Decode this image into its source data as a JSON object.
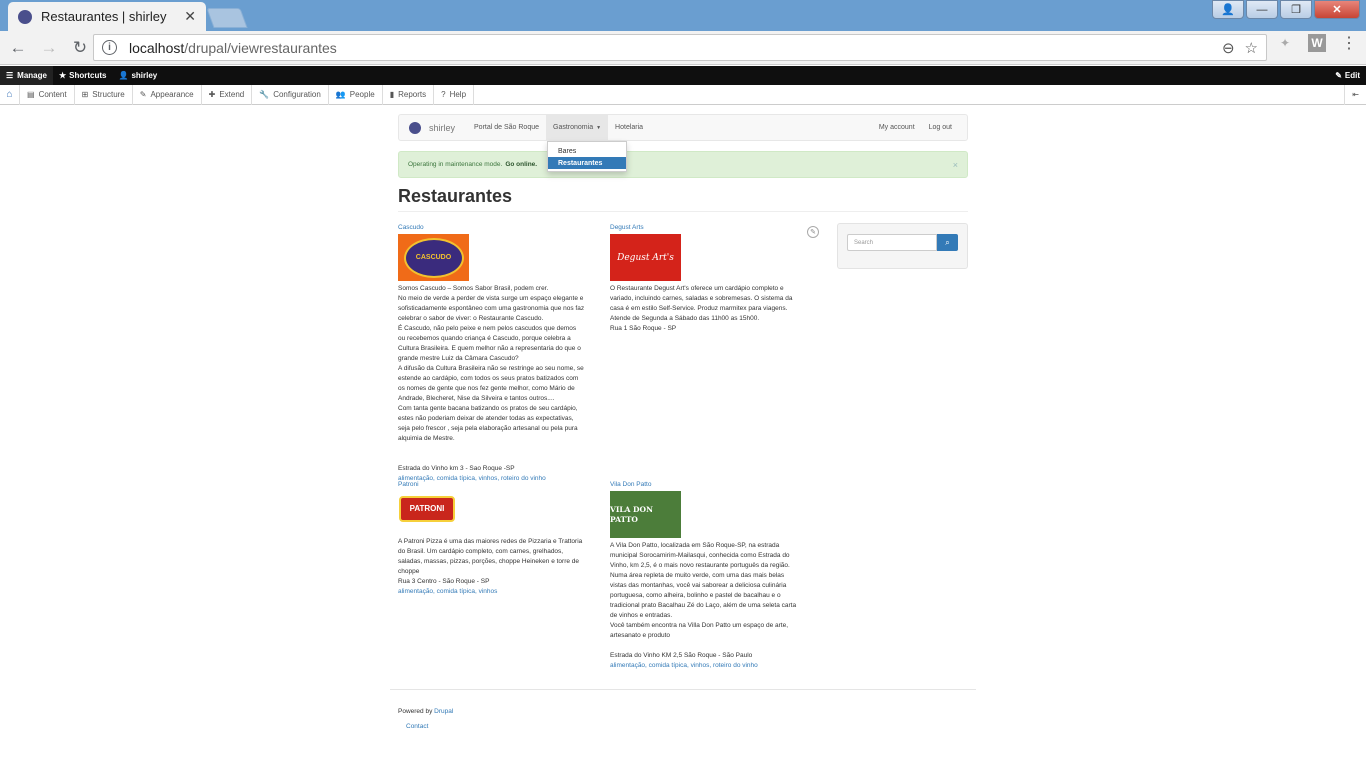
{
  "browser": {
    "tab_title": "Restaurantes | shirley",
    "tab_close": "✕",
    "url_host": "localhost",
    "url_path": "/drupal/viewrestaurantes",
    "back": "←",
    "forward": "→",
    "reload": "↻",
    "zoom_icon": "⊖",
    "star_icon": "☆",
    "menu_icon": "⋮",
    "ext_w": "W",
    "win_min": "—",
    "win_max": "❐",
    "win_close": "✕",
    "win_user": "👤"
  },
  "admin_bar": {
    "manage": "Manage",
    "shortcuts": "Shortcuts",
    "user": "shirley",
    "edit": "Edit"
  },
  "admin_tray": {
    "items": [
      "Content",
      "Structure",
      "Appearance",
      "Extend",
      "Configuration",
      "People",
      "Reports",
      "Help"
    ]
  },
  "site": {
    "brand": "shirley",
    "nav": [
      "Portal de São Roque",
      "Gastronomia",
      "Hotelaria"
    ],
    "nav_right": [
      "My account",
      "Log out"
    ],
    "dropdown": [
      "Bares",
      "Restaurantes"
    ]
  },
  "alert": {
    "text": "Operating in maintenance mode.",
    "link": "Go online.",
    "close": "×"
  },
  "page_title": "Restaurantes",
  "entries": [
    {
      "name": "Cascudo",
      "logo_text": "CASCUDO",
      "body": [
        "Somos Cascudo – Somos Sabor Brasil, podem crer.",
        "No meio de verde a perder de vista surge um espaço elegante e",
        "sofisticadamente espontâneo com uma gastronomia que nos faz",
        "celebrar o sabor de viver: o Restaurante Cascudo.",
        "É Cascudo, não pelo peixe e nem pelos cascudos que demos",
        "ou recebemos quando criança é Cascudo, porque celebra a",
        "Cultura Brasileira. E quem melhor não a representaria do que o",
        "grande mestre Luiz da Câmara Cascudo?",
        "A difusão da Cultura Brasileira não se restringe ao seu nome, se",
        "estende ao cardápio, com todos os seus pratos batizados com",
        "os nomes de gente que nos fez gente melhor, como Mário de",
        "Andrade, Blecheret, Nise da Silveira e tantos outros....",
        "Com tanta gente bacana batizando os pratos de seu cardápio,",
        "estes não poderiam deixar de atender todas as expectativas,",
        "seja pelo frescor , seja pela elaboração artesanal ou pela pura",
        "alquimia de Mestre.",
        "",
        "",
        "Estrada do Vinho km 3 - Sao Roque -SP"
      ],
      "tags": "alimentação, comida típica, vinhos, roteiro do vinho"
    },
    {
      "name": "Degust Arts",
      "logo_text": "Degust Art's",
      "body": [
        "O Restaurante Degust Art's oferece um cardápio completo e",
        "variado, incluindo carnes, saladas e sobremesas. O sistema da",
        "casa é em estilo Self-Service. Produz marmitex para viagens.",
        "Atende de Segunda a Sábado das 11h00 as 15h00.",
        "Rua 1 São Roque - SP"
      ],
      "tags": ""
    },
    {
      "name": "Patroni",
      "logo_text": "PATRONI",
      "body": [
        "A Patroni Pizza é uma das maiores redes de Pizzaria e Trattoria",
        "do Brasil. Um cardápio completo, com carnes, grelhados,",
        "saladas, massas, pizzas, porções, choppe Heineken e torre de",
        "choppe",
        "Rua 3 Centro - São Roque - SP"
      ],
      "tags": "alimentação, comida típica, vinhos"
    },
    {
      "name": "Vila Don Patto",
      "logo_text": "VILA DON PATTO",
      "body": [
        "A Vila Don Patto, localizada em São Roque-SP, na estrada",
        "municipal Sorocamirim-Mailasqui, conhecida como Estrada do",
        "Vinho, km 2,5, é o mais novo restaurante português da região.",
        "Numa área repleta de muito verde, com uma das mais belas",
        "vistas das montanhas, você vai saborear a deliciosa culinária",
        "portuguesa, como alheira, bolinho e pastel de bacalhau e o",
        "tradicional prato Bacalhau Zé do Laço, além de uma seleta carta",
        "de vinhos e entradas.",
        "Você também encontra na Villa Don Patto um espaço de arte,",
        "artesanato e produto",
        "",
        "Estrada do Vinho KM 2,5 São Roque - São Paulo"
      ],
      "tags": "alimentação, comida típica, vinhos, roteiro do vinho"
    }
  ],
  "search": {
    "placeholder": "Search",
    "button_icon": "⌕"
  },
  "footer": {
    "powered_by": "Powered by",
    "drupal": "Drupal",
    "contact": "Contact"
  }
}
